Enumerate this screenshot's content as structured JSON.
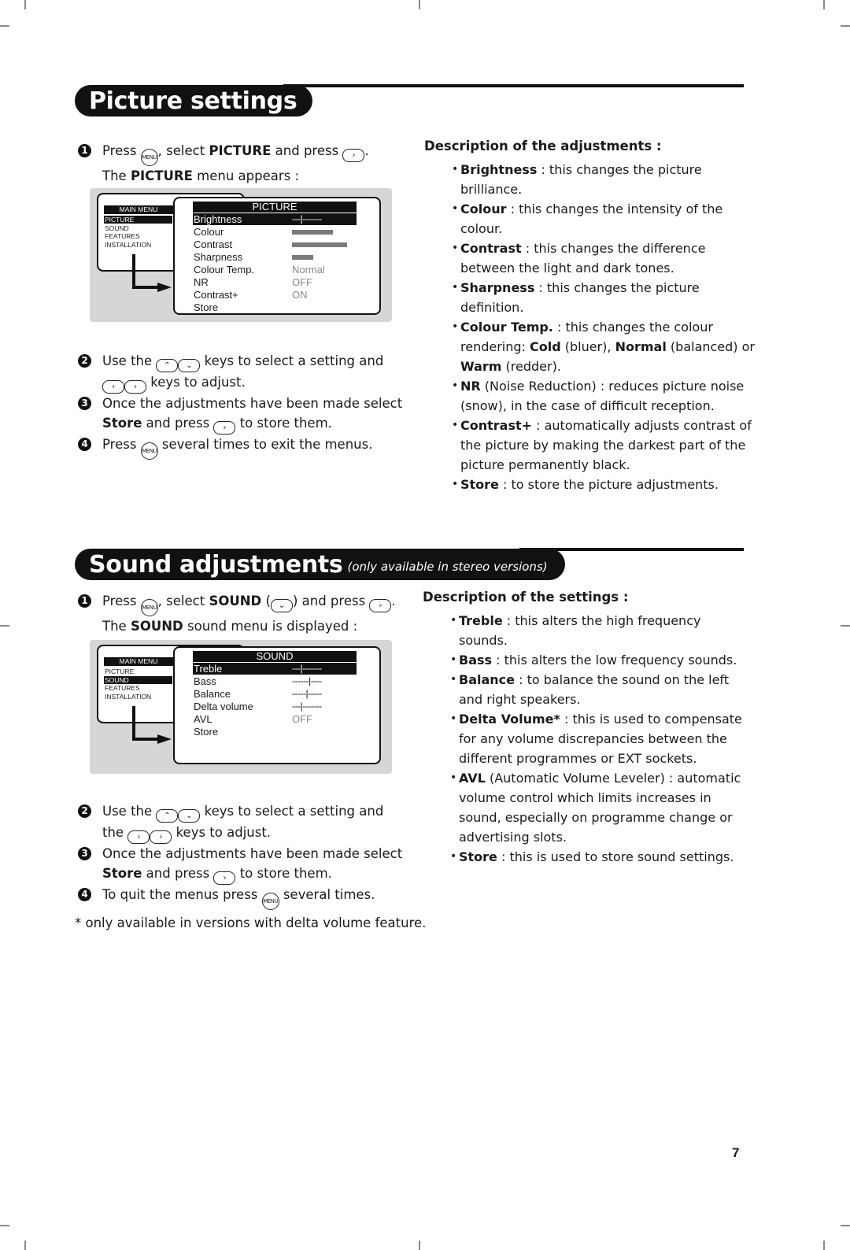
{
  "picture_section": {
    "title": "Picture settings",
    "steps": [
      {
        "num": "1",
        "parts": [
          "Press ",
          "MENU",
          ", select ",
          "PICTURE",
          " and press ",
          ">",
          "."
        ],
        "line2_parts": [
          "The ",
          "PICTURE",
          " menu appears :"
        ]
      },
      {
        "num": "2",
        "parts": [
          "Use the ",
          "^",
          "v",
          " keys to select a setting and"
        ],
        "line2_parts": [
          "<",
          ">",
          " keys to adjust."
        ]
      },
      {
        "num": "3",
        "parts": [
          "Once the adjustments have been made select"
        ],
        "line2_parts": [
          "Store",
          " and press ",
          ">",
          " to store them."
        ]
      },
      {
        "num": "4",
        "parts": [
          "Press ",
          "MENU",
          " several times to exit the menus."
        ]
      }
    ],
    "menu_diagram": {
      "main_menu_title": "MAIN MENU",
      "main_menu_items": [
        "PICTURE",
        "SOUND",
        "FEATURES",
        "INSTALLATION"
      ],
      "main_menu_selected": "PICTURE",
      "submenu_title": "PICTURE",
      "rows": [
        {
          "label": "Brightness",
          "value": "---|-------",
          "kind": "slider-text",
          "selected": true
        },
        {
          "label": "Colour",
          "kind": "bar",
          "level": 0.61
        },
        {
          "label": "Contrast",
          "kind": "bar",
          "level": 0.82
        },
        {
          "label": "Sharpness",
          "kind": "bar",
          "level": 0.32
        },
        {
          "label": "Colour Temp.",
          "value": "Normal",
          "kind": "text"
        },
        {
          "label": "NR",
          "value": "OFF",
          "kind": "text"
        },
        {
          "label": "Contrast+",
          "value": "ON",
          "kind": "text"
        },
        {
          "label": "Store",
          "kind": "none"
        }
      ]
    },
    "description": {
      "heading": "Description of the adjustments :",
      "items": [
        {
          "term": "Brightness",
          "text": " : this changes the picture brilliance."
        },
        {
          "term": "Colour",
          "text": " : this changes the intensity of the colour."
        },
        {
          "term": "Contrast",
          "text": " : this changes the difference between the light and dark tones."
        },
        {
          "term": "Sharpness",
          "text": " : this changes the picture definition."
        },
        {
          "term": "Colour Temp.",
          "text": " : this changes the colour rendering: ",
          "extra": [
            {
              "b": "Cold"
            },
            {
              "t": " (bluer), "
            },
            {
              "b": "Normal"
            },
            {
              "t": " (balanced) or "
            },
            {
              "b": "Warm"
            },
            {
              "t": " (redder)."
            }
          ]
        },
        {
          "term": "NR",
          "text": " (Noise Reduction) : reduces picture noise (snow), in the case of difficult reception."
        },
        {
          "term": "Contrast+",
          "text": " : automatically adjusts contrast of the picture by making the darkest part of the picture permanently black."
        },
        {
          "term": "Store",
          "text": " : to store the picture adjustments."
        }
      ]
    }
  },
  "sound_section": {
    "title": "Sound adjustments",
    "subtitle": "(only available in stereo versions)",
    "steps": [
      {
        "num": "1",
        "parts": [
          "Press ",
          "MENU",
          ", select ",
          "SOUND",
          " (",
          "v",
          ") and press ",
          ">",
          "."
        ],
        "line2_parts": [
          "The ",
          "SOUND",
          " sound menu is displayed :"
        ]
      },
      {
        "num": "2",
        "parts": [
          "Use the ",
          "^",
          "v",
          " keys to select a setting and"
        ],
        "line2_parts": [
          "the ",
          "<",
          ">",
          " keys to adjust."
        ]
      },
      {
        "num": "3",
        "parts": [
          "Once the adjustments have been made select"
        ],
        "line2_parts": [
          "Store",
          " and press ",
          ">",
          " to store them."
        ]
      },
      {
        "num": "4",
        "parts": [
          "To quit the menus press ",
          "MENU",
          " several times."
        ]
      }
    ],
    "menu_diagram": {
      "main_menu_title": "MAIN MENU",
      "main_menu_items": [
        "PICTURE",
        "SOUND",
        "FEATURES",
        "INSTALLATION"
      ],
      "main_menu_selected": "SOUND",
      "submenu_title": "SOUND",
      "rows": [
        {
          "label": "Treble",
          "value": "---|-------",
          "kind": "slider-text",
          "selected": true
        },
        {
          "label": "Bass",
          "value": "------|----",
          "kind": "slider-text"
        },
        {
          "label": "Balance",
          "value": "-----|-----",
          "kind": "slider-text"
        },
        {
          "label": "Delta volume",
          "value": "---|-------",
          "kind": "slider-text"
        },
        {
          "label": "AVL",
          "value": "OFF",
          "kind": "text"
        },
        {
          "label": "Store",
          "kind": "none"
        }
      ]
    },
    "description": {
      "heading": "Description of the settings :",
      "items": [
        {
          "term": "Treble",
          "text": " : this alters the high frequency sounds."
        },
        {
          "term": "Bass",
          "text": " : this alters the low frequency sounds."
        },
        {
          "term": "Balance",
          "text": " : to balance the sound on the left and right speakers."
        },
        {
          "term": "Delta Volume*",
          "text": " : this is used to compensate for any volume discrepancies between the different programmes or EXT sockets."
        },
        {
          "term": "AVL",
          "text": " (Automatic Volume Leveler) : automatic volume control which limits increases in sound, especially on programme change or advertising slots."
        },
        {
          "term": "Store",
          "text": " : this is used to store sound settings."
        }
      ]
    }
  },
  "key_labels": {
    "menu": "MENU",
    "up": "⌃",
    "down": "⌄",
    "left": "‹",
    "right": "›"
  },
  "footnote": "* only available in versions with delta volume feature.",
  "page_number": "7"
}
